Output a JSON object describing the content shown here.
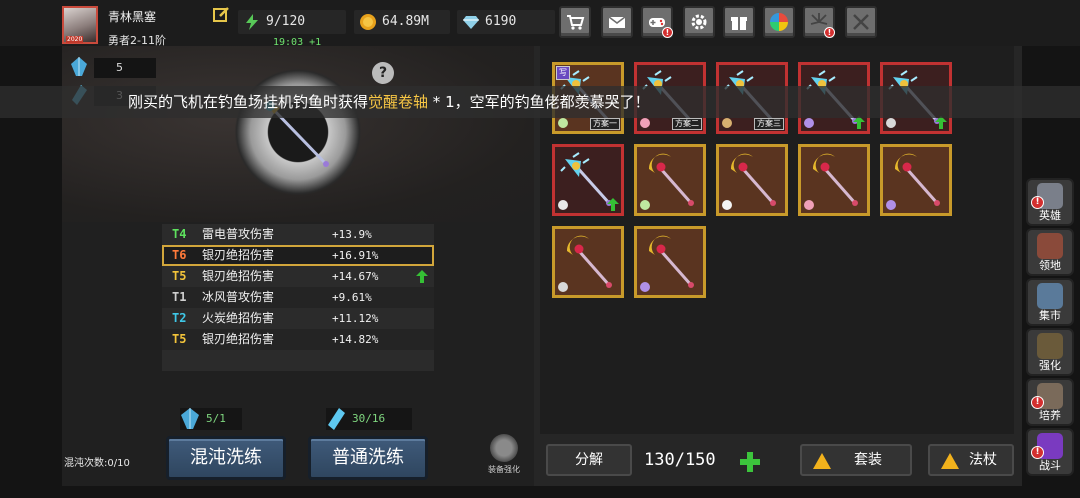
{
  "player": {
    "name": "青林黑塞",
    "rank": "勇者2-11阶",
    "avatar_tag": "2020"
  },
  "resources": {
    "energy": "9/120",
    "energy_regen": "19:03 +1",
    "gold": "64.89M",
    "gems": "6190"
  },
  "toolbar_icons": [
    "cart-icon",
    "mail-icon",
    "gamepad-icon",
    "gear-icon",
    "gift-icon",
    "color-wheel-icon",
    "fireworks-icon",
    "crossed-swords-icon"
  ],
  "left": {
    "crystal_blue_count": "5",
    "crystal_cyan_count": "3",
    "stats": [
      {
        "tier": "T4",
        "tier_color": "#5ee25e",
        "name": "雷电普攻伤害",
        "value": "+13.9%",
        "selected": false,
        "up": false
      },
      {
        "tier": "T6",
        "tier_color": "#ff7a3a",
        "name": "银刃绝招伤害",
        "value": "+16.91%",
        "selected": true,
        "up": false
      },
      {
        "tier": "T5",
        "tier_color": "#f3c43a",
        "name": "银刃绝招伤害",
        "value": "+14.67%",
        "selected": false,
        "up": true
      },
      {
        "tier": "T1",
        "tier_color": "#cfcfcf",
        "name": "冰风普攻伤害",
        "value": "+9.61%",
        "selected": false,
        "up": false
      },
      {
        "tier": "T2",
        "tier_color": "#3fc8e8",
        "name": "火炭绝招伤害",
        "value": "+11.12%",
        "selected": false,
        "up": false
      },
      {
        "tier": "T5",
        "tier_color": "#f3c43a",
        "name": "银刃绝招伤害",
        "value": "+14.82%",
        "selected": false,
        "up": false
      }
    ],
    "chaos_cost": "5/1",
    "normal_cost": "30/16",
    "chaos_count": "混沌次数:0/10",
    "chaos_button": "混沌洗练",
    "normal_button": "普通洗练",
    "enhance_label": "装备强化"
  },
  "toast": {
    "prefix": "刚买的飞机在钓鱼场挂机钓鱼时获得",
    "item": "觉醒卷轴",
    "suffix": " * 1，空军的钓鱼佬都羡慕哭了！"
  },
  "inventory": {
    "capacity": "130/150",
    "decompose_button": "分解",
    "set_button": "套装",
    "staff_button": "法杖",
    "items": [
      {
        "style": "gold",
        "weapon": "ice",
        "corner": "leaf",
        "plan": "方案一",
        "top": "写"
      },
      {
        "style": "red",
        "weapon": "ice",
        "corner": "rose",
        "plan": "方案二"
      },
      {
        "style": "red",
        "weapon": "ice",
        "corner": "tower",
        "plan": "方案三"
      },
      {
        "style": "red",
        "weapon": "ice",
        "corner": "blade",
        "up": true
      },
      {
        "style": "red",
        "weapon": "ice",
        "corner": "cross",
        "up": true
      },
      {
        "style": "red",
        "weapon": "ice",
        "corner": "claw",
        "up": true
      },
      {
        "style": "gold",
        "weapon": "crescent",
        "corner": "leaf"
      },
      {
        "style": "gold",
        "weapon": "crescent",
        "corner": "skull"
      },
      {
        "style": "gold",
        "weapon": "crescent",
        "corner": "rose"
      },
      {
        "style": "gold",
        "weapon": "crescent",
        "corner": "blade"
      },
      {
        "style": "gold",
        "weapon": "crescent",
        "corner": "cross"
      },
      {
        "style": "gold",
        "weapon": "crescent",
        "corner": "blade"
      }
    ]
  },
  "sidenav": [
    {
      "label": "英雄",
      "name": "hero",
      "badge": true,
      "color": "#7a7f8a"
    },
    {
      "label": "领地",
      "name": "territory",
      "badge": false,
      "color": "#8a4a3a"
    },
    {
      "label": "集市",
      "name": "market",
      "badge": false,
      "color": "#5a7a9a"
    },
    {
      "label": "强化",
      "name": "enhance",
      "badge": false,
      "color": "#6a5a3a"
    },
    {
      "label": "培养",
      "name": "cultivate",
      "badge": true,
      "color": "#7a6a5a"
    },
    {
      "label": "战斗",
      "name": "battle",
      "badge": true,
      "color": "#7a3ac0"
    }
  ]
}
